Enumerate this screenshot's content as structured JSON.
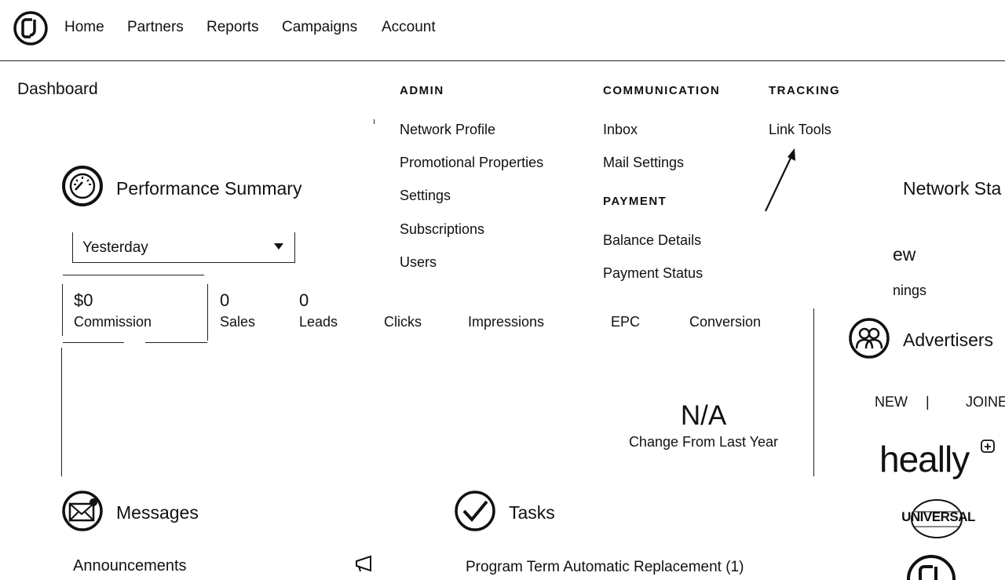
{
  "nav": {
    "items": [
      "Home",
      "Partners",
      "Reports",
      "Campaigns",
      "Account"
    ]
  },
  "dashboard": {
    "title": "Dashboard",
    "performance": {
      "title": "Performance Summary",
      "period": "Yesterday",
      "metrics": [
        {
          "value": "$0",
          "label": "Commission"
        },
        {
          "value": "0",
          "label": "Sales"
        },
        {
          "value": "0",
          "label": "Leads"
        },
        {
          "value": "",
          "label": "Clicks"
        },
        {
          "value": "",
          "label": "Impressions"
        },
        {
          "value": "",
          "label": "EPC"
        },
        {
          "value": "",
          "label": "Conversion"
        }
      ],
      "change_value": "N/A",
      "change_label": "Change From Last Year"
    },
    "messages": {
      "title": "Messages",
      "announcements": "Announcements"
    },
    "tasks": {
      "title": "Tasks",
      "item": "Program Term Automatic Replacement (1)"
    },
    "network": {
      "title": "Network Sta",
      "view_fragment": "ew",
      "earnings_fragment": "nings"
    },
    "advertisers": {
      "title": "Advertisers",
      "tab_new": "NEW",
      "tab_separator": "|",
      "tab_joined": "JOINE",
      "logo_healthy": "heally",
      "logo_universal": "UNIVERSAL"
    }
  },
  "menu": {
    "admin": {
      "heading": "ADMIN",
      "links": [
        "Network Profile",
        "Promotional Properties",
        "Settings",
        "Subscriptions",
        "Users"
      ]
    },
    "communication": {
      "heading": "COMMUNICATION",
      "links": [
        "Inbox",
        "Mail Settings"
      ]
    },
    "payment": {
      "heading": "PAYMENT",
      "links": [
        "Balance Details",
        "Payment Status"
      ]
    },
    "tracking": {
      "heading": "TRACKING",
      "links": [
        "Link Tools"
      ]
    }
  }
}
